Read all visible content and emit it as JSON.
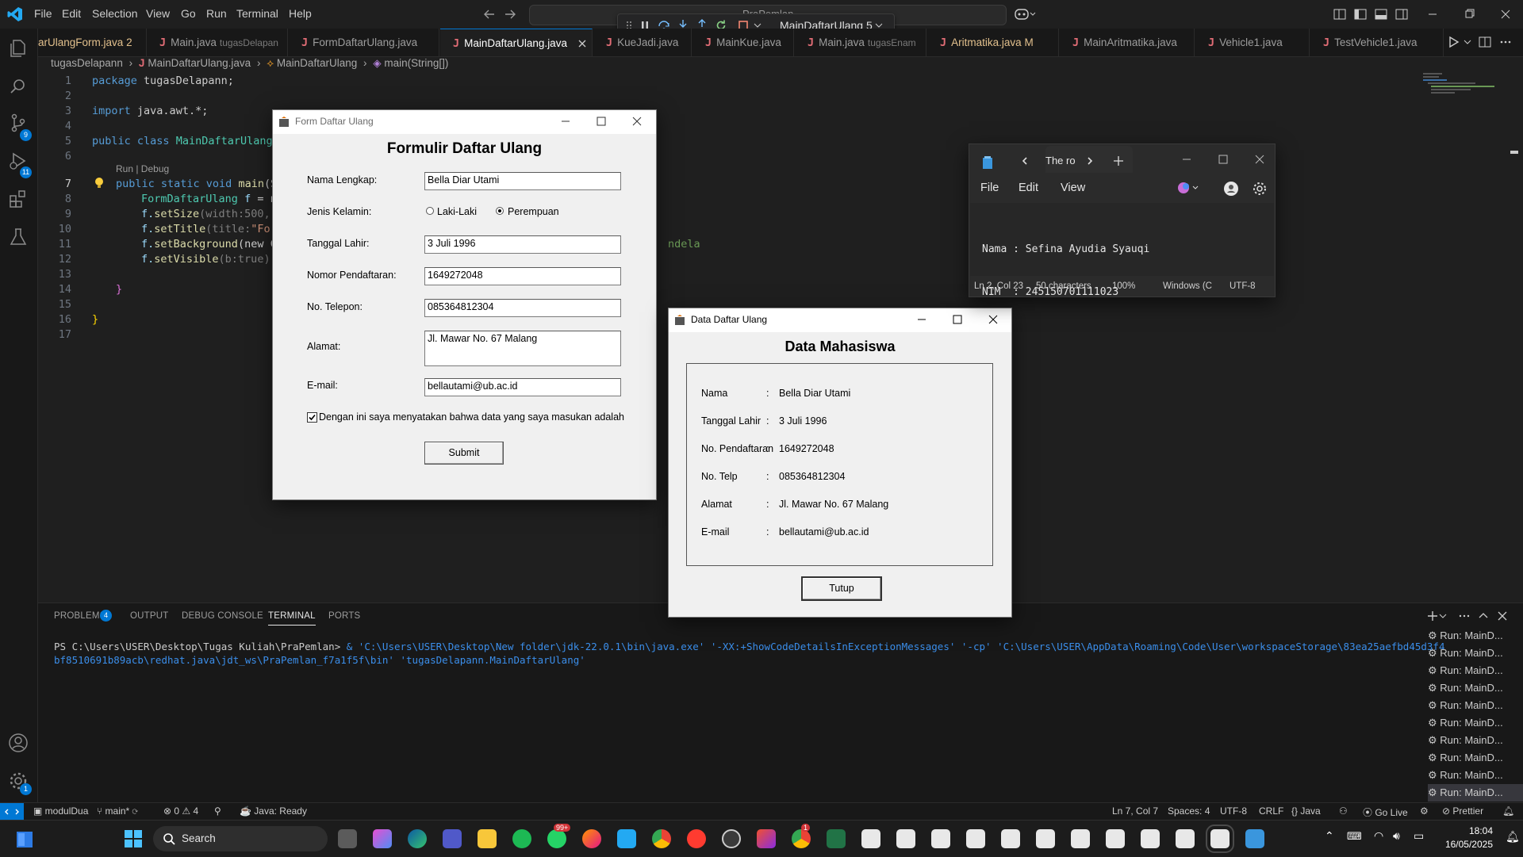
{
  "menu": [
    "File",
    "Edit",
    "Selection",
    "View",
    "Go",
    "Run",
    "Terminal",
    "Help"
  ],
  "command_center": {
    "label": "PraPemlan"
  },
  "debug": {
    "config": "MainDaftarUlang 5"
  },
  "activity_badges": {
    "scm": "9",
    "run": "11",
    "settings": "1"
  },
  "tabs": [
    {
      "label": "arUlangForm.java",
      "sub": "2",
      "color": "#e2c08d"
    },
    {
      "label": "Main.java",
      "sub": "tugasDelapan"
    },
    {
      "label": "FormDaftarUlang.java",
      "sub": ""
    },
    {
      "label": "MainDaftarUlang.java",
      "sub": "",
      "active": true
    },
    {
      "label": "KueJadi.java",
      "sub": ""
    },
    {
      "label": "MainKue.java",
      "sub": ""
    },
    {
      "label": "Main.java",
      "sub": "tugasEnam"
    },
    {
      "label": "Aritmatika.java",
      "sub": "M",
      "color": "#e2c08d"
    },
    {
      "label": "MainAritmatika.java",
      "sub": ""
    },
    {
      "label": "Vehicle1.java",
      "sub": ""
    },
    {
      "label": "TestVehicle1.java",
      "sub": ""
    }
  ],
  "breadcrumb": {
    "folder": "tugasDelapann",
    "file": "MainDaftarUlang.java",
    "cls": "MainDaftarUlang",
    "method": "main(String[])"
  },
  "codelens": "Run | Debug",
  "line_numbers": [
    "1",
    "2",
    "3",
    "4",
    "5",
    "6",
    "7",
    "8",
    "9",
    "10",
    "11",
    "12",
    "13",
    "14",
    "15",
    "16",
    "17"
  ],
  "code": {
    "l1_kw": "package",
    "l1_rest": "tugasDelapann;",
    "l3_kw": "import",
    "l3_rest": "java.awt.*;",
    "l5_a": "public class",
    "l5_b": "MainDaftarUlang",
    "l7_a": "public static void",
    "l7_b": "main",
    "l7_c": "(St",
    "l8_a": "FormDaftarUlang",
    "l8_b": "f",
    "l8_c": "= ne",
    "l9_a": "f.",
    "l9_b": "setSize",
    "l9_c": "(width:500, h",
    "l10_a": "f.",
    "l10_b": "setTitle",
    "l10_c": "(title:",
    "l10_d": "\"For",
    "l11_a": "f.",
    "l11_b": "setBackground",
    "l11_c": "(new Co",
    "l11_tail": "ndela",
    "l12_a": "f.",
    "l12_b": "setVisible",
    "l12_c": "(b:true);",
    "l14": "}",
    "l16": "}"
  },
  "panel": {
    "tabs": [
      "PROBLEMS",
      "OUTPUT",
      "DEBUG CONSOLE",
      "TERMINAL",
      "PORTS"
    ],
    "problems_count": "4",
    "prompt": "PS C:\\Users\\USER\\Desktop\\Tugas Kuliah\\PraPemlan>",
    "command": " & 'C:\\Users\\USER\\Desktop\\New folder\\jdk-22.0.1\\bin\\java.exe' '-XX:+ShowCodeDetailsInExceptionMessages' '-cp' 'C:\\Users\\USER\\AppData\\Roaming\\Code\\User\\workspaceStorage\\83ea25aefbd45d3f4bf8510691b89acb\\redhat.java\\jdt_ws\\PraPemlan_f7a1f5f\\bin' 'tugasDelapann.MainDaftarUlang'",
    "terminals": [
      "Run: MainD...",
      "Run: MainD...",
      "Run: MainD...",
      "Run: MainD...",
      "Run: MainD...",
      "Run: MainD...",
      "Run: MainD...",
      "Run: MainD...",
      "Run: MainD...",
      "Run: MainD..."
    ]
  },
  "status": {
    "project": "modulDua",
    "branch": "main*",
    "errors": "0",
    "warnings": "4",
    "java": "Java: Ready",
    "position": "Ln 7, Col 7",
    "spaces": "Spaces: 4",
    "encoding": "UTF-8",
    "eol": "CRLF",
    "lang": "Java",
    "golive": "Go Live",
    "prettier": "Prettier"
  },
  "taskbar": {
    "search": "Search",
    "time": "18:04",
    "date": "16/05/2025",
    "whatsapp_badge": "99+",
    "chrome_badge": "1"
  },
  "form": {
    "window_title": "Form Daftar Ulang",
    "heading": "Formulir Daftar Ulang",
    "labels": {
      "nama": "Nama Lengkap:",
      "jk": "Jenis Kelamin:",
      "tgl": "Tanggal Lahir:",
      "nomor": "Nomor Pendaftaran:",
      "telp": "No. Telepon:",
      "alamat": "Alamat:",
      "email": "E-mail:"
    },
    "values": {
      "nama": "Bella Diar Utami",
      "tgl": "3 Juli 1996",
      "nomor": "1649272048",
      "telp": "085364812304",
      "alamat": "Jl. Mawar No. 67 Malang",
      "email": "bellautami@ub.ac.id"
    },
    "gender_options": [
      "Laki-Laki",
      "Perempuan"
    ],
    "gender_selected": "Perempuan",
    "agree": "Dengan ini saya menyatakan bahwa data yang saya masukan adalah",
    "agree_checked": true,
    "submit": "Submit"
  },
  "data_window": {
    "window_title": "Data Daftar Ulang",
    "heading": "Data Mahasiswa",
    "rows": [
      {
        "label": "Nama",
        "sep": ":",
        "value": "Bella Diar Utami"
      },
      {
        "label": "Tanggal Lahir",
        "sep": ":",
        "value": "3 Juli 1996"
      },
      {
        "label": "No. Pendaftaran",
        "sep": ":",
        "value": "1649272048"
      },
      {
        "label": "No. Telp",
        "sep": ":",
        "value": "085364812304"
      },
      {
        "label": "Alamat",
        "sep": ":",
        "value": "Jl. Mawar No. 67 Malang"
      },
      {
        "label": "E-mail",
        "sep": ":",
        "value": "bellautami@ub.ac.id"
      }
    ],
    "close": "Tutup"
  },
  "notepad": {
    "tab": "The ro",
    "menu": [
      "File",
      "Edit",
      "View"
    ],
    "line1": "Nama : Sefina Ayudia Syauqi",
    "line2": "NIM  : 245150701111023",
    "status": {
      "pos": "Ln 2, Col 23",
      "chars": "50 characters",
      "zoom": "100%",
      "eol": "Windows (C",
      "enc": "UTF-8"
    }
  },
  "colors": {
    "accent": "#0078d4",
    "tab_java": "#e06c75",
    "string": "#ce9178",
    "keyword": "#569cd6"
  }
}
